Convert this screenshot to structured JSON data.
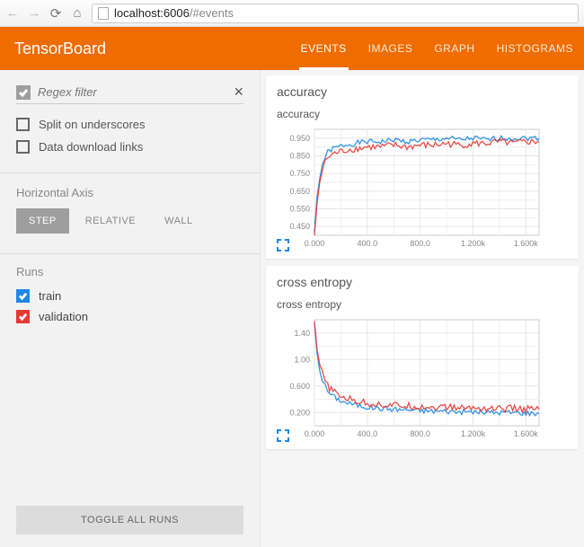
{
  "url_host": "localhost:6006",
  "url_path": "/#events",
  "brand": "TensorBoard",
  "top_tabs": [
    "EVENTS",
    "IMAGES",
    "GRAPH",
    "HISTOGRAMS"
  ],
  "active_tab": 0,
  "sidebar": {
    "filter_placeholder": "Regex filter",
    "split_label": "Split on underscores",
    "download_label": "Data download links",
    "haxis_label": "Horizontal Axis",
    "haxis_options": [
      "STEP",
      "RELATIVE",
      "WALL"
    ],
    "haxis_active": 0,
    "runs_label": "Runs",
    "runs": [
      {
        "name": "train",
        "color": "blue"
      },
      {
        "name": "validation",
        "color": "red"
      }
    ],
    "toggle_all": "TOGGLE ALL RUNS"
  },
  "cards": [
    {
      "section": "accuracy",
      "chart": 0
    },
    {
      "section": "cross entropy",
      "chart": 1
    }
  ],
  "chart_data": [
    {
      "type": "line",
      "title": "accuracy",
      "xlabel": "",
      "ylabel": "",
      "xlim": [
        0,
        1700
      ],
      "ylim": [
        0.4,
        1.0
      ],
      "xticks": [
        0,
        400,
        800,
        1200,
        1600
      ],
      "xtick_labels": [
        "0.000",
        "400.0",
        "800.0",
        "1.200k",
        "1.600k"
      ],
      "yticks": [
        0.45,
        0.55,
        0.65,
        0.75,
        0.85,
        0.95
      ],
      "ytick_labels": [
        "0.450",
        "0.550",
        "0.650",
        "0.750",
        "0.850",
        "0.950"
      ],
      "series": [
        {
          "name": "train",
          "color": "#1e88e5",
          "x": [
            0,
            20,
            40,
            60,
            80,
            100,
            140,
            180,
            220,
            300,
            400,
            500,
            600,
            700,
            800,
            900,
            1000,
            1100,
            1200,
            1300,
            1400,
            1500,
            1600,
            1700
          ],
          "y": [
            0.42,
            0.62,
            0.73,
            0.8,
            0.84,
            0.87,
            0.89,
            0.9,
            0.91,
            0.92,
            0.93,
            0.93,
            0.94,
            0.93,
            0.94,
            0.94,
            0.95,
            0.94,
            0.95,
            0.94,
            0.95,
            0.95,
            0.95,
            0.95
          ]
        },
        {
          "name": "validation",
          "color": "#e53935",
          "x": [
            0,
            20,
            40,
            60,
            80,
            100,
            140,
            180,
            220,
            300,
            400,
            500,
            600,
            700,
            800,
            900,
            1000,
            1100,
            1200,
            1300,
            1400,
            1500,
            1600,
            1700
          ],
          "y": [
            0.4,
            0.58,
            0.7,
            0.77,
            0.81,
            0.84,
            0.86,
            0.87,
            0.88,
            0.89,
            0.9,
            0.9,
            0.91,
            0.9,
            0.91,
            0.91,
            0.92,
            0.91,
            0.92,
            0.92,
            0.93,
            0.92,
            0.93,
            0.93
          ]
        }
      ]
    },
    {
      "type": "line",
      "title": "cross entropy",
      "xlabel": "",
      "ylabel": "",
      "xlim": [
        0,
        1700
      ],
      "ylim": [
        0.0,
        1.6
      ],
      "xticks": [
        0,
        400,
        800,
        1200,
        1600
      ],
      "xtick_labels": [
        "0.000",
        "400.0",
        "800.0",
        "1.200k",
        "1.600k"
      ],
      "yticks": [
        0.2,
        0.6,
        1.0,
        1.4
      ],
      "ytick_labels": [
        "0.200",
        "0.600",
        "1.00",
        "1.40"
      ],
      "series": [
        {
          "name": "train",
          "color": "#1e88e5",
          "x": [
            0,
            20,
            40,
            60,
            80,
            100,
            140,
            180,
            220,
            300,
            400,
            500,
            600,
            700,
            800,
            900,
            1000,
            1100,
            1200,
            1300,
            1400,
            1500,
            1600,
            1700
          ],
          "y": [
            1.55,
            1.1,
            0.85,
            0.7,
            0.6,
            0.52,
            0.45,
            0.4,
            0.36,
            0.32,
            0.28,
            0.26,
            0.25,
            0.24,
            0.23,
            0.22,
            0.22,
            0.21,
            0.21,
            0.2,
            0.2,
            0.2,
            0.19,
            0.19
          ]
        },
        {
          "name": "validation",
          "color": "#e53935",
          "x": [
            0,
            20,
            40,
            60,
            80,
            100,
            140,
            180,
            220,
            300,
            400,
            500,
            600,
            700,
            800,
            900,
            1000,
            1100,
            1200,
            1300,
            1400,
            1500,
            1600,
            1700
          ],
          "y": [
            1.58,
            1.15,
            0.92,
            0.78,
            0.68,
            0.6,
            0.52,
            0.47,
            0.43,
            0.38,
            0.34,
            0.32,
            0.31,
            0.3,
            0.29,
            0.28,
            0.28,
            0.27,
            0.27,
            0.26,
            0.26,
            0.26,
            0.25,
            0.25
          ]
        }
      ]
    }
  ]
}
